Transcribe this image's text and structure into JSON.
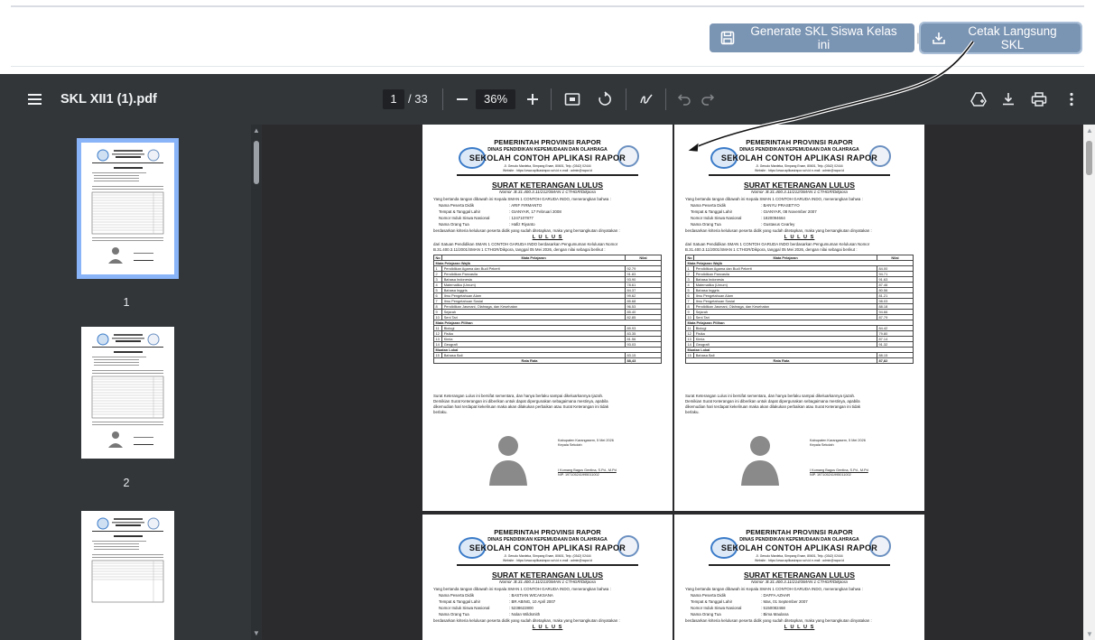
{
  "webbar": {
    "generate_label": "Generate SKL Siswa Kelas ini",
    "separator": "|",
    "print_label": "Cetak Langsung SKL"
  },
  "viewer": {
    "file_name": "SKL XII1 (1).pdf",
    "current_page": "1",
    "total_pages": "/ 33",
    "zoom": "36%"
  },
  "thumbnails": [
    {
      "label": "1",
      "selected": true
    },
    {
      "label": "2",
      "selected": false
    },
    {
      "label": "",
      "selected": false
    }
  ],
  "doc_header": {
    "line1": "PEMERINTAH PROVINSI RAPOR",
    "line2": "DINAS PENDIDIKAN KEPEMUDAAN DAN OLAHRAGA",
    "line3": "SEKOLAH CONTOH APLIKASI RAPOR",
    "line4": "Jl. Gerudo Mardeka, Simpang Enam, 80601, Telp. (0342) 02444",
    "line5": "Website : https://www.aplikasirapor.sch.id   e-mail : admin@rapor.id",
    "title": "SURAT KETERANGAN LULUS",
    "intro": "Yang bertanda tangan dibawah ini Kepala SMAN 1 CONTOH GARUDA INDO, menerangkan bahwa :",
    "field_labels": [
      "Nama Peserta Didik",
      "Tempat & Tanggal Lahir",
      "Nomor Induk Siswa Nasional",
      "Nama Orang Tua"
    ],
    "criteria": "berdasarkan kriteria kelulusan peserta didik yang sudah ditetapkan, maka yang bersangkutan dinyatakan :",
    "lulus": "L U L U S",
    "body1": "dari Satuan Pendidikan SMAN 1 CONTOH GARUDA INDO berdasarkan Pengumuman Kelulusan Nomor",
    "body2": "B.31.400.3.11/2001/SMAN 1 CTHGR/Dikpora, tanggal 05 Mei 2026, dengan nilai sebagai berikut :",
    "col_no": "No",
    "col_subject": "Mata Pelajaran",
    "col_score": "Nilai",
    "sect_wajib": "Mata Pelajaran Wajib",
    "sect_pilihan": "Mata Pelajaran Pilihan",
    "sect_lokal": "Muatan Lokal",
    "avg_label": "Rata Rata",
    "subjects_wajib": [
      "Pendidikan Agama dan Budi Pekerti",
      "Pendidikan Pancasila",
      "Bahasa Indonesia",
      "Matematika (Umum)",
      "Bahasa Inggris",
      "Ilmu Pengetahuan Alam",
      "Ilmu Pengetahuan Sosial",
      "Pendidikan Jasmani, Olahraga, dan Kesehatan",
      "Sejarah",
      "Seni Tari"
    ],
    "subjects_pilihan": [
      "Biologi",
      "Fisika",
      "Kimia",
      "Geografi"
    ],
    "subjects_lokal": [
      "Bahasa Bali"
    ],
    "closing1": "Surat Keterangan Lulus ini bersifat sementara, dan hanya berlaku sampai dikeluarkannya Ijazah.",
    "closing2": "Demikian Surat Keterangan ini diberikan untuk dapat dipergunakan sebagaimana mestinya, apabila",
    "closing3": "dikemudian hari terdapat kekeliruan maka akan dilakukan perbaikan atau Surat Keterangan ini tidak",
    "closing4": "berlaku.",
    "sign_place": "Kabupaten Karangasem, 5 Mei 2026",
    "sign_role": "Kepala Sekolah",
    "sign_name": "I Komang Bagus Gentina, S.Pd., M.Pd",
    "sign_nip": "NIP. 197105241995011002"
  },
  "pages": [
    {
      "nomor": "Nomor :B.31.400.3.11/212/SMAN 1 CTHGR/Dikpora",
      "values": [
        ": ARIF FIRMANTO",
        ": GIANYAR, 17 Februari 2008",
        ": 1247107877",
        ": Hafiz Riyanto"
      ],
      "scores_wajib": [
        "92.79",
        "91.83",
        "93.90",
        "78.61",
        "84.37",
        "99.62",
        "85.68",
        "96.53",
        "85.40",
        "82.85"
      ],
      "scores_pilihan": [
        "89.93",
        "83.35",
        "81.56",
        "93.03"
      ],
      "scores_lokal": [
        "83.15"
      ],
      "average": "88,43"
    },
    {
      "nomor": "Nomor :B.31.400.3.11/212/SMAN 1 CTHGR/Dikpora",
      "values": [
        ": BANYU PRASETYO",
        ": GIANYAR, 08 November 2007",
        ": 1820094664",
        ": Gustavus Cearley"
      ],
      "scores_wajib": [
        "84.00",
        "94.71",
        "91.63",
        "87.46",
        "80.56",
        "81.21",
        "98.03",
        "88.18",
        "94.66",
        "87.79"
      ],
      "scores_pilihan": [
        "84.42",
        "79.80",
        "87.14",
        "91.32"
      ],
      "scores_lokal": [
        "88.15"
      ],
      "average": "87,82"
    },
    {
      "nomor": "Nomor :B.31.400.3.11/213/SMAN 1 CTHGR/Dikpora",
      "values": [
        ": BASTIAN WICAKSANA",
        ": BR ABING, 10 April 2007",
        ": 5238622800",
        ": Nolan Wildsmith"
      ]
    },
    {
      "nomor": "Nomor :B.31.400.3.11/214/SMAN 1 CTHGR/Dikpora",
      "values": [
        ": DAFFA AZHAR",
        ": Mas, 01 September 2007",
        ": 5150082468",
        ": Bima Maulana"
      ]
    }
  ]
}
